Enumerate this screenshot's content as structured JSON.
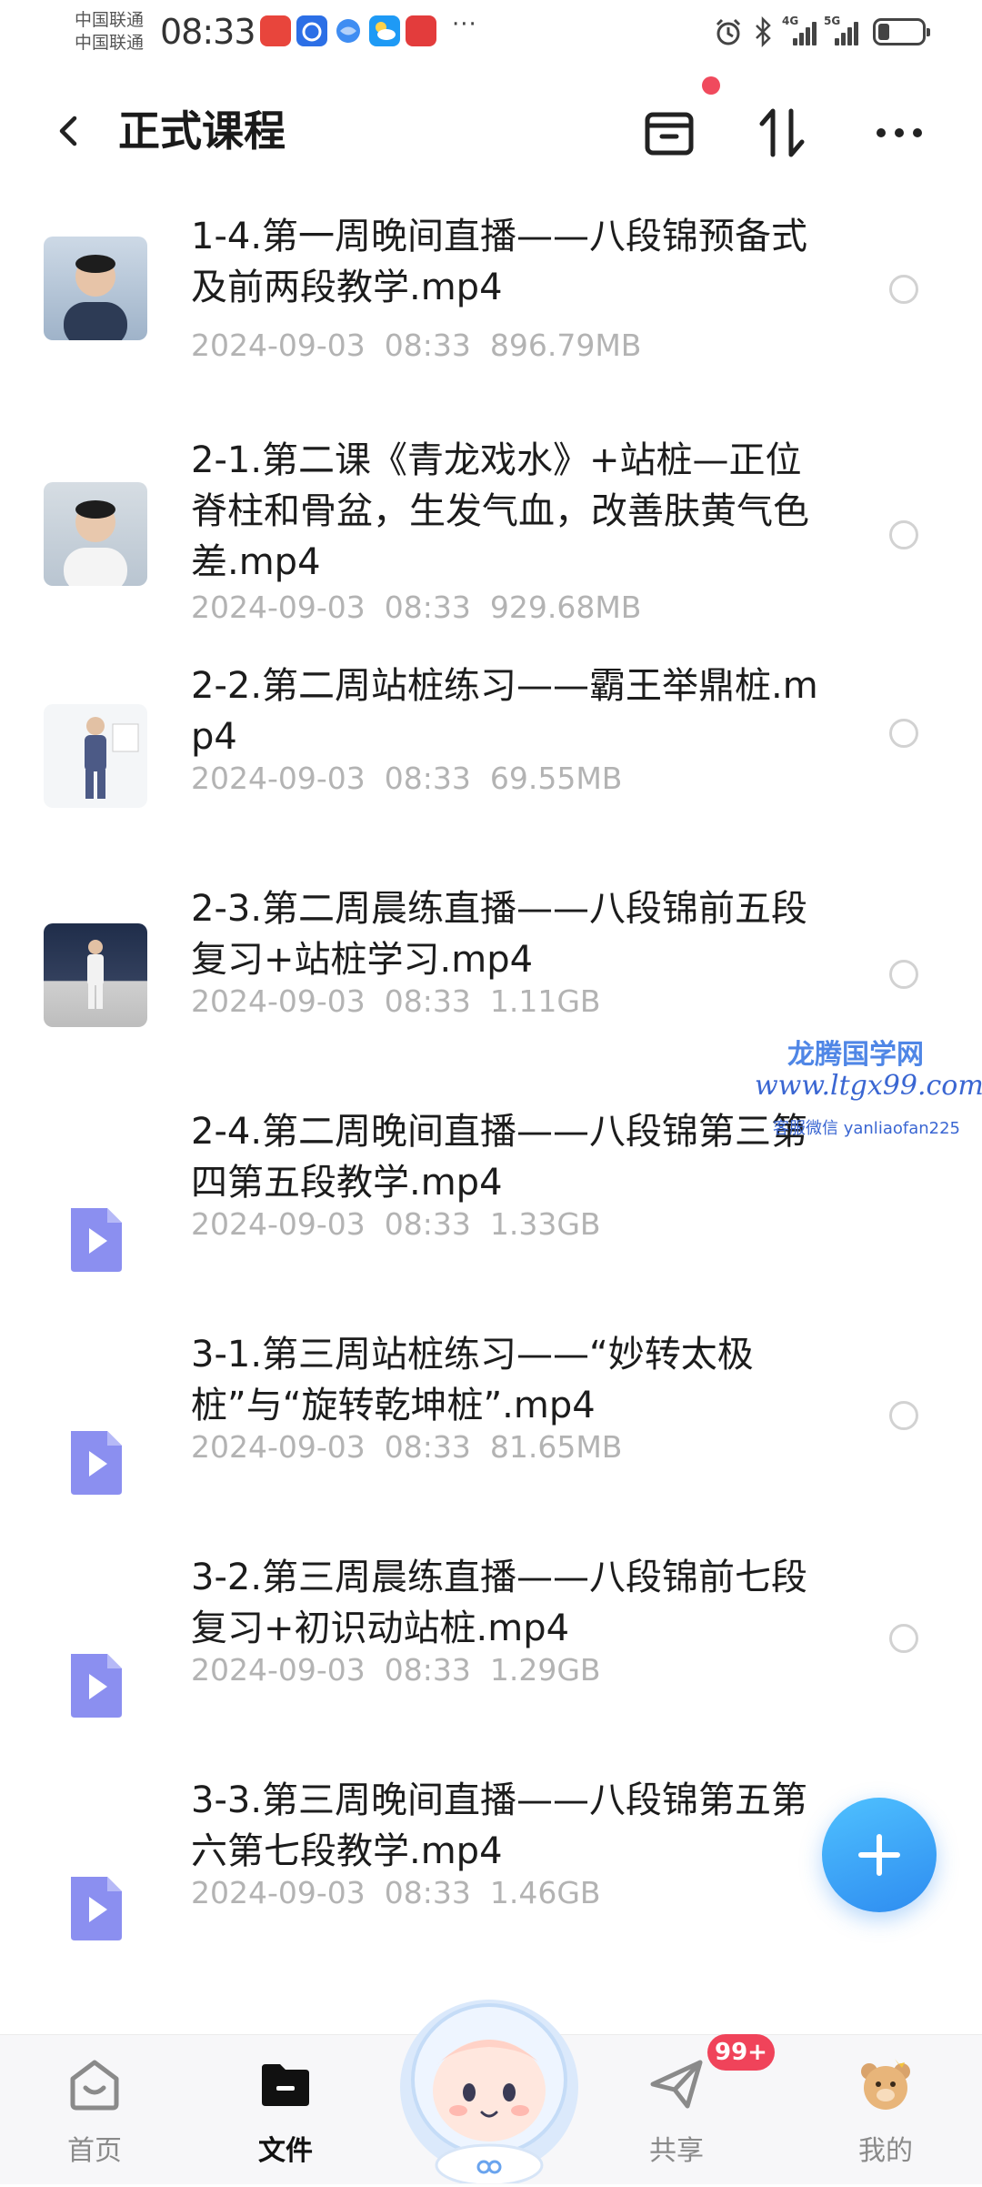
{
  "status_bar": {
    "carrier_1": "中国联通",
    "carrier_2": "中国联通",
    "time": "08:33",
    "more": "···",
    "network_1": "4G",
    "network_2": "5G",
    "battery_level": 0.25
  },
  "header": {
    "title": "正式课程",
    "back_icon": "chevron-left-icon",
    "actions": [
      "archive-icon",
      "sort-icon",
      "more-icon"
    ]
  },
  "files": [
    {
      "name": "1-4.第一周晚间直播——八段锦预备式及前两段教学.mp4",
      "date": "2024-09-03",
      "time": "08:33",
      "size": "896.79MB",
      "icon": "video-thumbnail"
    },
    {
      "name": "2-1.第二课《青龙戏水》+站桩—正位脊柱和骨盆，生发气血，改善肤黄气色差.mp4",
      "date": "2024-09-03",
      "time": "08:33",
      "size": "929.68MB",
      "icon": "video-thumbnail"
    },
    {
      "name": "2-2.第二周站桩练习——霸王举鼎桩.mp4",
      "date": "2024-09-03",
      "time": "08:33",
      "size": "69.55MB",
      "icon": "video-thumbnail"
    },
    {
      "name": "2-3.第二周晨练直播——八段锦前五段复习+站桩学习.mp4",
      "date": "2024-09-03",
      "time": "08:33",
      "size": "1.11GB",
      "icon": "video-thumbnail"
    },
    {
      "name": "2-4.第二周晚间直播——八段锦第三第四第五段教学.mp4",
      "date": "2024-09-03",
      "time": "08:33",
      "size": "1.33GB",
      "icon": "video-file-icon"
    },
    {
      "name": "3-1.第三周站桩练习——“妙转太极桩”与“旋转乾坤桩”.mp4",
      "date": "2024-09-03",
      "time": "08:33",
      "size": "81.65MB",
      "icon": "video-file-icon"
    },
    {
      "name": "3-2.第三周晨练直播——八段锦前七段复习+初识动站桩.mp4",
      "date": "2024-09-03",
      "time": "08:33",
      "size": "1.29GB",
      "icon": "video-file-icon"
    },
    {
      "name": "3-3.第三周晚间直播——八段锦第五第六第七段教学.mp4",
      "date": "2024-09-03",
      "time": "08:33",
      "size": "1.46GB",
      "icon": "video-file-icon"
    }
  ],
  "watermark": {
    "title": "龙腾国学网",
    "url": "www.ltgx99.com",
    "contact": "客服微信 yanliaofan225"
  },
  "fab": {
    "icon": "plus-icon"
  },
  "nav": {
    "items": [
      {
        "label": "首页",
        "icon": "home-icon"
      },
      {
        "label": "文件",
        "icon": "folder-icon",
        "active": true
      },
      {
        "label": "共享",
        "icon": "paper-plane-icon"
      },
      {
        "label": "我的",
        "icon": "bear-avatar-icon"
      }
    ],
    "share_badge": "99+"
  },
  "colors": {
    "accent": "#2e8cf0",
    "badge": "#f0435a",
    "meta_text": "#b3b3b3",
    "file_icon": "#8b8ff0"
  }
}
